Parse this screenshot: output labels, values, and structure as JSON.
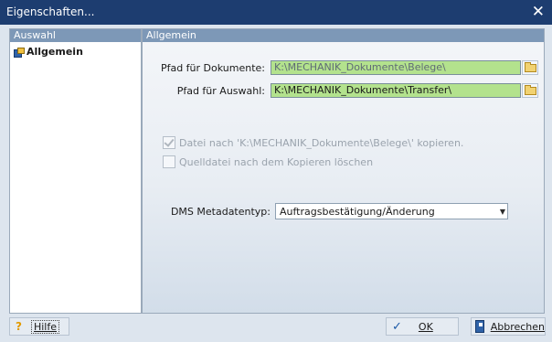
{
  "window": {
    "title": "Eigenschaften...",
    "close_glyph": "✕"
  },
  "left_pane": {
    "header": "Auswahl",
    "items": [
      {
        "label": "Allgemein",
        "icon": "properties-icon"
      }
    ]
  },
  "right_pane": {
    "header": "Allgemein",
    "fields": {
      "documents_path": {
        "label": "Pfad für Dokumente:",
        "value": "K:\\MECHANIK_Dokumente\\Belege\\"
      },
      "selection_path": {
        "label": "Pfad für Auswahl:",
        "value": "K:\\MECHANIK_Dokumente\\Transfer\\"
      }
    },
    "checkboxes": [
      {
        "label": "Datei nach 'K:\\MECHANIK_Dokumente\\Belege\\' kopieren.",
        "checked": true
      },
      {
        "label": "Quelldatei nach dem Kopieren löschen",
        "checked": false
      }
    ],
    "dms": {
      "label": "DMS Metadatentyp:",
      "selected": "Auftragsbestätigung/Änderung"
    }
  },
  "footer": {
    "help_label": "Hilfe",
    "ok_label": "OK",
    "cancel_label": "Abbrechen"
  },
  "colors": {
    "titlebar": "#1d3d70",
    "input_green": "#b3e28d",
    "pane_header": "#7d98b7"
  }
}
